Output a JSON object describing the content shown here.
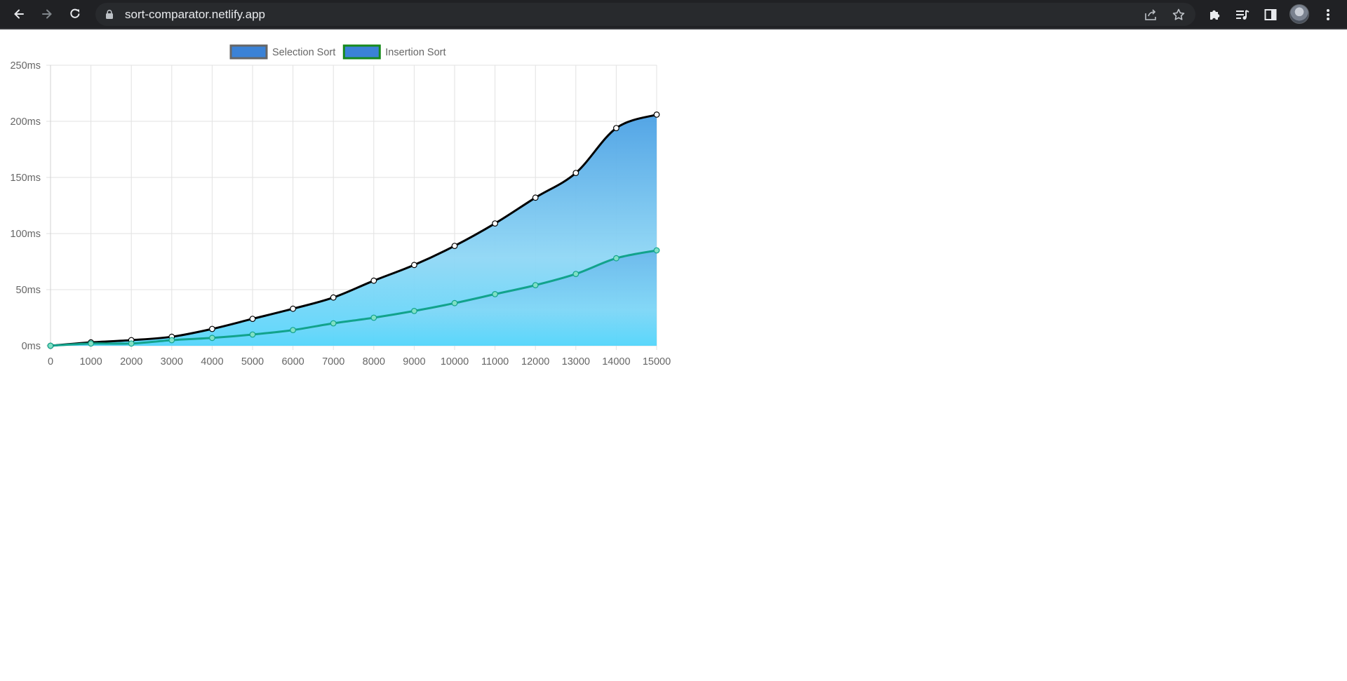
{
  "browser": {
    "url": "sort-comparator.netlify.app",
    "icons": [
      "back-arrow-icon",
      "forward-arrow-icon",
      "reload-icon",
      "lock-icon",
      "share-icon",
      "star-icon",
      "extensions-icon",
      "media-control-icon",
      "side-panel-icon",
      "profile-avatar",
      "kebab-menu-icon"
    ]
  },
  "chart_data": {
    "type": "area",
    "x": [
      0,
      1000,
      2000,
      3000,
      4000,
      5000,
      6000,
      7000,
      8000,
      9000,
      10000,
      11000,
      12000,
      13000,
      14000,
      15000
    ],
    "series": [
      {
        "name": "Selection Sort",
        "values": [
          0,
          3,
          5,
          8,
          15,
          24,
          33,
          43,
          58,
          72,
          89,
          109,
          132,
          154,
          194,
          206
        ],
        "line_color": "#000000",
        "point_fill": "#ffffff",
        "legend_fill": "#3b82d6",
        "legend_border": "#666666"
      },
      {
        "name": "Insertion Sort",
        "values": [
          0,
          2,
          2,
          5,
          7,
          10,
          14,
          20,
          25,
          31,
          38,
          46,
          54,
          64,
          78,
          85
        ],
        "line_color": "#12a38c",
        "point_fill": "#7fe0c4",
        "legend_fill": "#3b82d6",
        "legend_border": "#178a1c"
      }
    ],
    "fill_gradient": [
      "#4aa0e4",
      "#8fd7f5",
      "#56d6fb"
    ],
    "ylim": [
      0,
      250
    ],
    "yticks": [
      "0ms",
      "50ms",
      "100ms",
      "150ms",
      "200ms",
      "250ms"
    ],
    "ytick_values": [
      0,
      50,
      100,
      150,
      200,
      250
    ],
    "xticks": [
      "0",
      "1000",
      "2000",
      "3000",
      "4000",
      "5000",
      "6000",
      "7000",
      "8000",
      "9000",
      "10000",
      "11000",
      "12000",
      "13000",
      "14000",
      "15000"
    ],
    "grid": true,
    "legend_position": "top"
  }
}
